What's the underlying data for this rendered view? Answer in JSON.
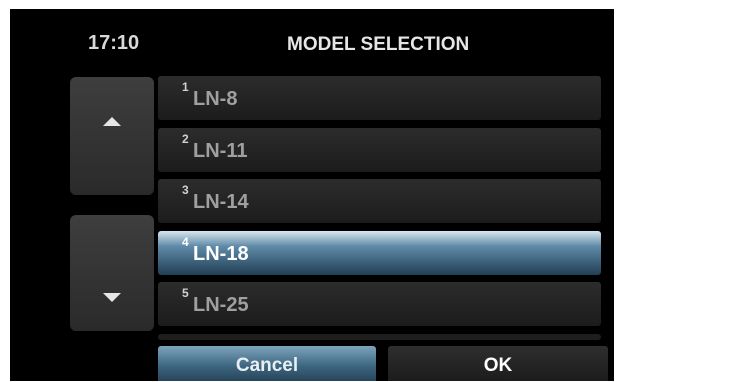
{
  "header": {
    "time": "17:10",
    "title": "MODEL SELECTION"
  },
  "models": [
    {
      "number": "1",
      "label": "LN-8",
      "selected": false
    },
    {
      "number": "2",
      "label": "LN-11",
      "selected": false
    },
    {
      "number": "3",
      "label": "LN-14",
      "selected": false
    },
    {
      "number": "4",
      "label": "LN-18",
      "selected": true
    },
    {
      "number": "5",
      "label": "LN-25",
      "selected": false
    }
  ],
  "buttons": {
    "cancel": "Cancel",
    "ok": "OK"
  },
  "colors": {
    "selected_accent": "#4f7fa0",
    "background": "#000000"
  }
}
